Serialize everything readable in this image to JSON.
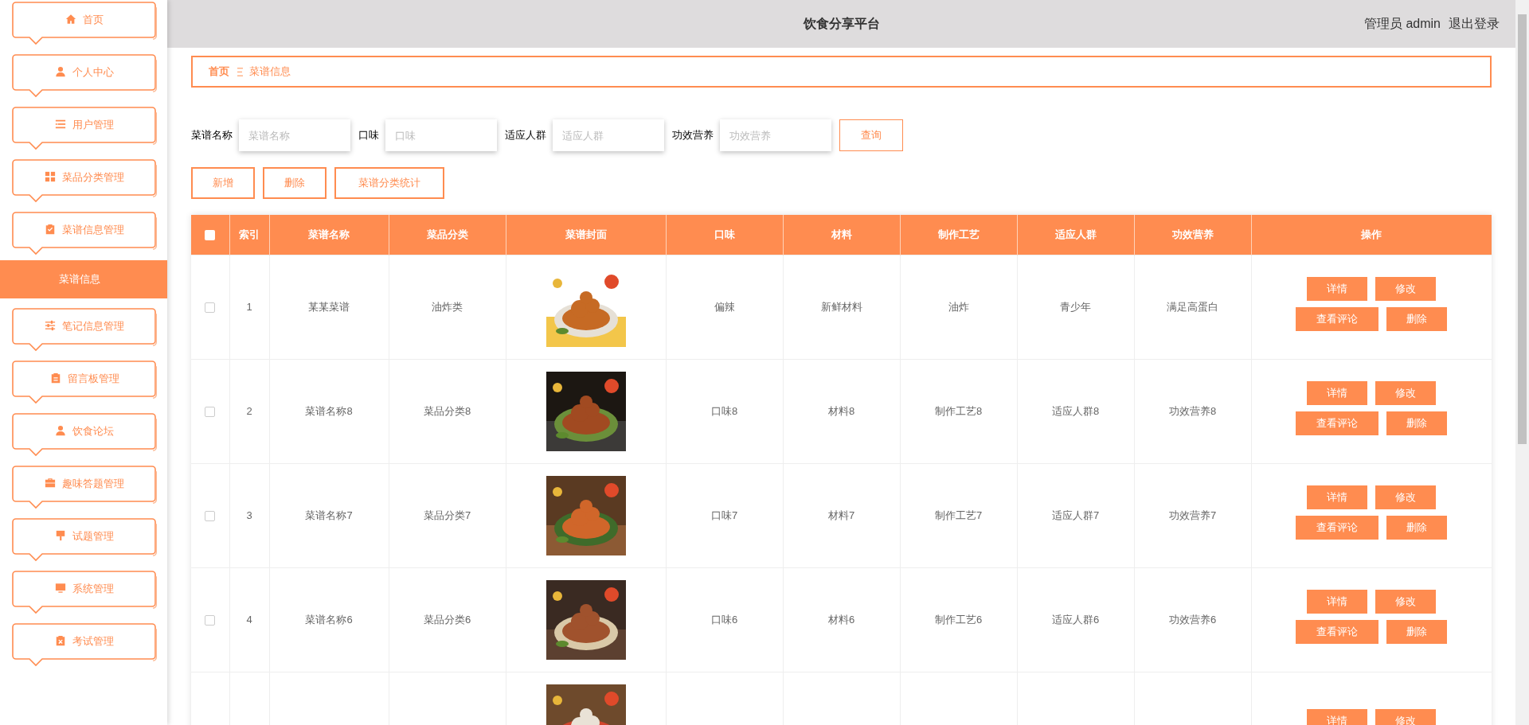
{
  "sidebar": {
    "items": [
      {
        "label": "首页",
        "selected": false
      },
      {
        "label": "个人中心",
        "selected": false
      },
      {
        "label": "用户管理",
        "selected": false
      },
      {
        "label": "菜品分类管理",
        "selected": false
      },
      {
        "label": "菜谱信息管理",
        "selected": false,
        "children": [
          {
            "label": "菜谱信息",
            "selected": true
          }
        ]
      },
      {
        "label": "笔记信息管理",
        "selected": false
      },
      {
        "label": "留言板管理",
        "selected": false
      },
      {
        "label": "饮食论坛",
        "selected": false
      },
      {
        "label": "趣味答题管理",
        "selected": false
      },
      {
        "label": "试题管理",
        "selected": false
      },
      {
        "label": "系统管理",
        "selected": false
      },
      {
        "label": "考试管理",
        "selected": false
      }
    ]
  },
  "header": {
    "title": "饮食分享平台",
    "user": "管理员 admin",
    "logout": "退出登录"
  },
  "breadcrumb": [
    "首页",
    "菜谱信息"
  ],
  "search": {
    "fields": [
      {
        "label": "菜谱名称",
        "placeholder": "菜谱名称"
      },
      {
        "label": "口味",
        "placeholder": "口味"
      },
      {
        "label": "适应人群",
        "placeholder": "适应人群"
      },
      {
        "label": "功效营养",
        "placeholder": "功效营养"
      }
    ],
    "button": "查询"
  },
  "actions": [
    "新增",
    "删除",
    "菜谱分类统计"
  ],
  "table": {
    "header_checkbox": {
      "checked": false
    },
    "columns": [
      "索引",
      "菜谱名称",
      "菜品分类",
      "菜谱封面",
      "口味",
      "材料",
      "制作工艺",
      "适应人群",
      "功效营养",
      "操作"
    ],
    "rows": [
      {
        "checked": false,
        "index": "1",
        "name": "某某菜谱",
        "category": "油炸类",
        "cover": {
          "kind": "picture"
        },
        "taste": "偏辣",
        "material": "新鲜材料",
        "process": "油炸",
        "crowd": "青少年",
        "nutrition": "满足高蛋白",
        "buttons": [
          "详情",
          "修改",
          "查看评论",
          "删除"
        ]
      },
      {
        "checked": false,
        "index": "2",
        "name": "菜谱名称8",
        "category": "菜品分类8",
        "cover": {
          "kind": "picture"
        },
        "taste": "口味8",
        "material": "材料8",
        "process": "制作工艺8",
        "crowd": "适应人群8",
        "nutrition": "功效营养8",
        "buttons": [
          "详情",
          "修改",
          "查看评论",
          "删除"
        ]
      },
      {
        "checked": false,
        "index": "3",
        "name": "菜谱名称7",
        "category": "菜品分类7",
        "cover": {
          "kind": "picture"
        },
        "taste": "口味7",
        "material": "材料7",
        "process": "制作工艺7",
        "crowd": "适应人群7",
        "nutrition": "功效营养7",
        "buttons": [
          "详情",
          "修改",
          "查看评论",
          "删除"
        ]
      },
      {
        "checked": false,
        "index": "4",
        "name": "菜谱名称6",
        "category": "菜品分类6",
        "cover": {
          "kind": "picture"
        },
        "taste": "口味6",
        "material": "材料6",
        "process": "制作工艺6",
        "crowd": "适应人群6",
        "nutrition": "功效营养6",
        "buttons": [
          "详情",
          "修改",
          "查看评论",
          "删除"
        ]
      },
      {
        "cover": {
          "kind": "picture"
        },
        "buttons": [
          "详情",
          "修改"
        ]
      }
    ]
  }
}
